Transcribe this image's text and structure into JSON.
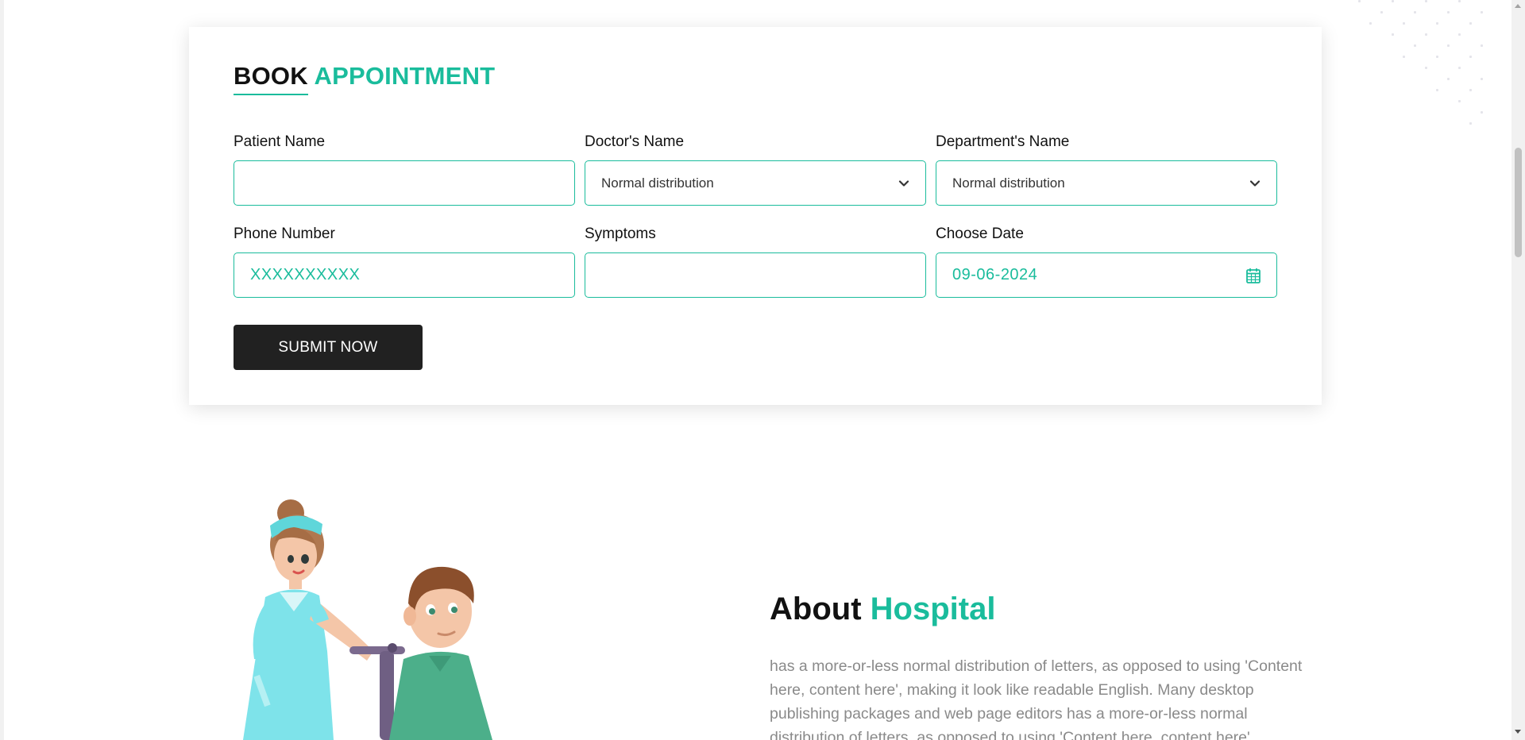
{
  "booking": {
    "title_part1": "BOOK",
    "title_part2": "APPOINTMENT",
    "fields": {
      "patient_name": {
        "label": "Patient Name",
        "value": ""
      },
      "doctor_name": {
        "label": "Doctor's Name",
        "selected": "Normal distribution"
      },
      "department_name": {
        "label": "Department's Name",
        "selected": "Normal distribution"
      },
      "phone_number": {
        "label": "Phone Number",
        "placeholder": "XXXXXXXXXX"
      },
      "symptoms": {
        "label": "Symptoms",
        "value": ""
      },
      "choose_date": {
        "label": "Choose Date",
        "value": "09-06-2024"
      }
    },
    "submit_label": "SUBMIT NOW"
  },
  "about": {
    "title_part1": "About",
    "title_part2": "Hospital",
    "text": "has a more-or-less normal distribution of letters, as opposed to using 'Content here, content here', making it look like readable English. Many desktop publishing packages and web page editors has a more-or-less normal distribution of letters, as opposed to using 'Content here, content here'"
  },
  "icons": {
    "doctor_select": "chevron-down-icon",
    "department_select": "chevron-down-icon",
    "date_picker": "calendar-icon"
  },
  "colors": {
    "accent": "#1abc9c",
    "button": "#212121",
    "body_text": "#8a8a8a"
  }
}
